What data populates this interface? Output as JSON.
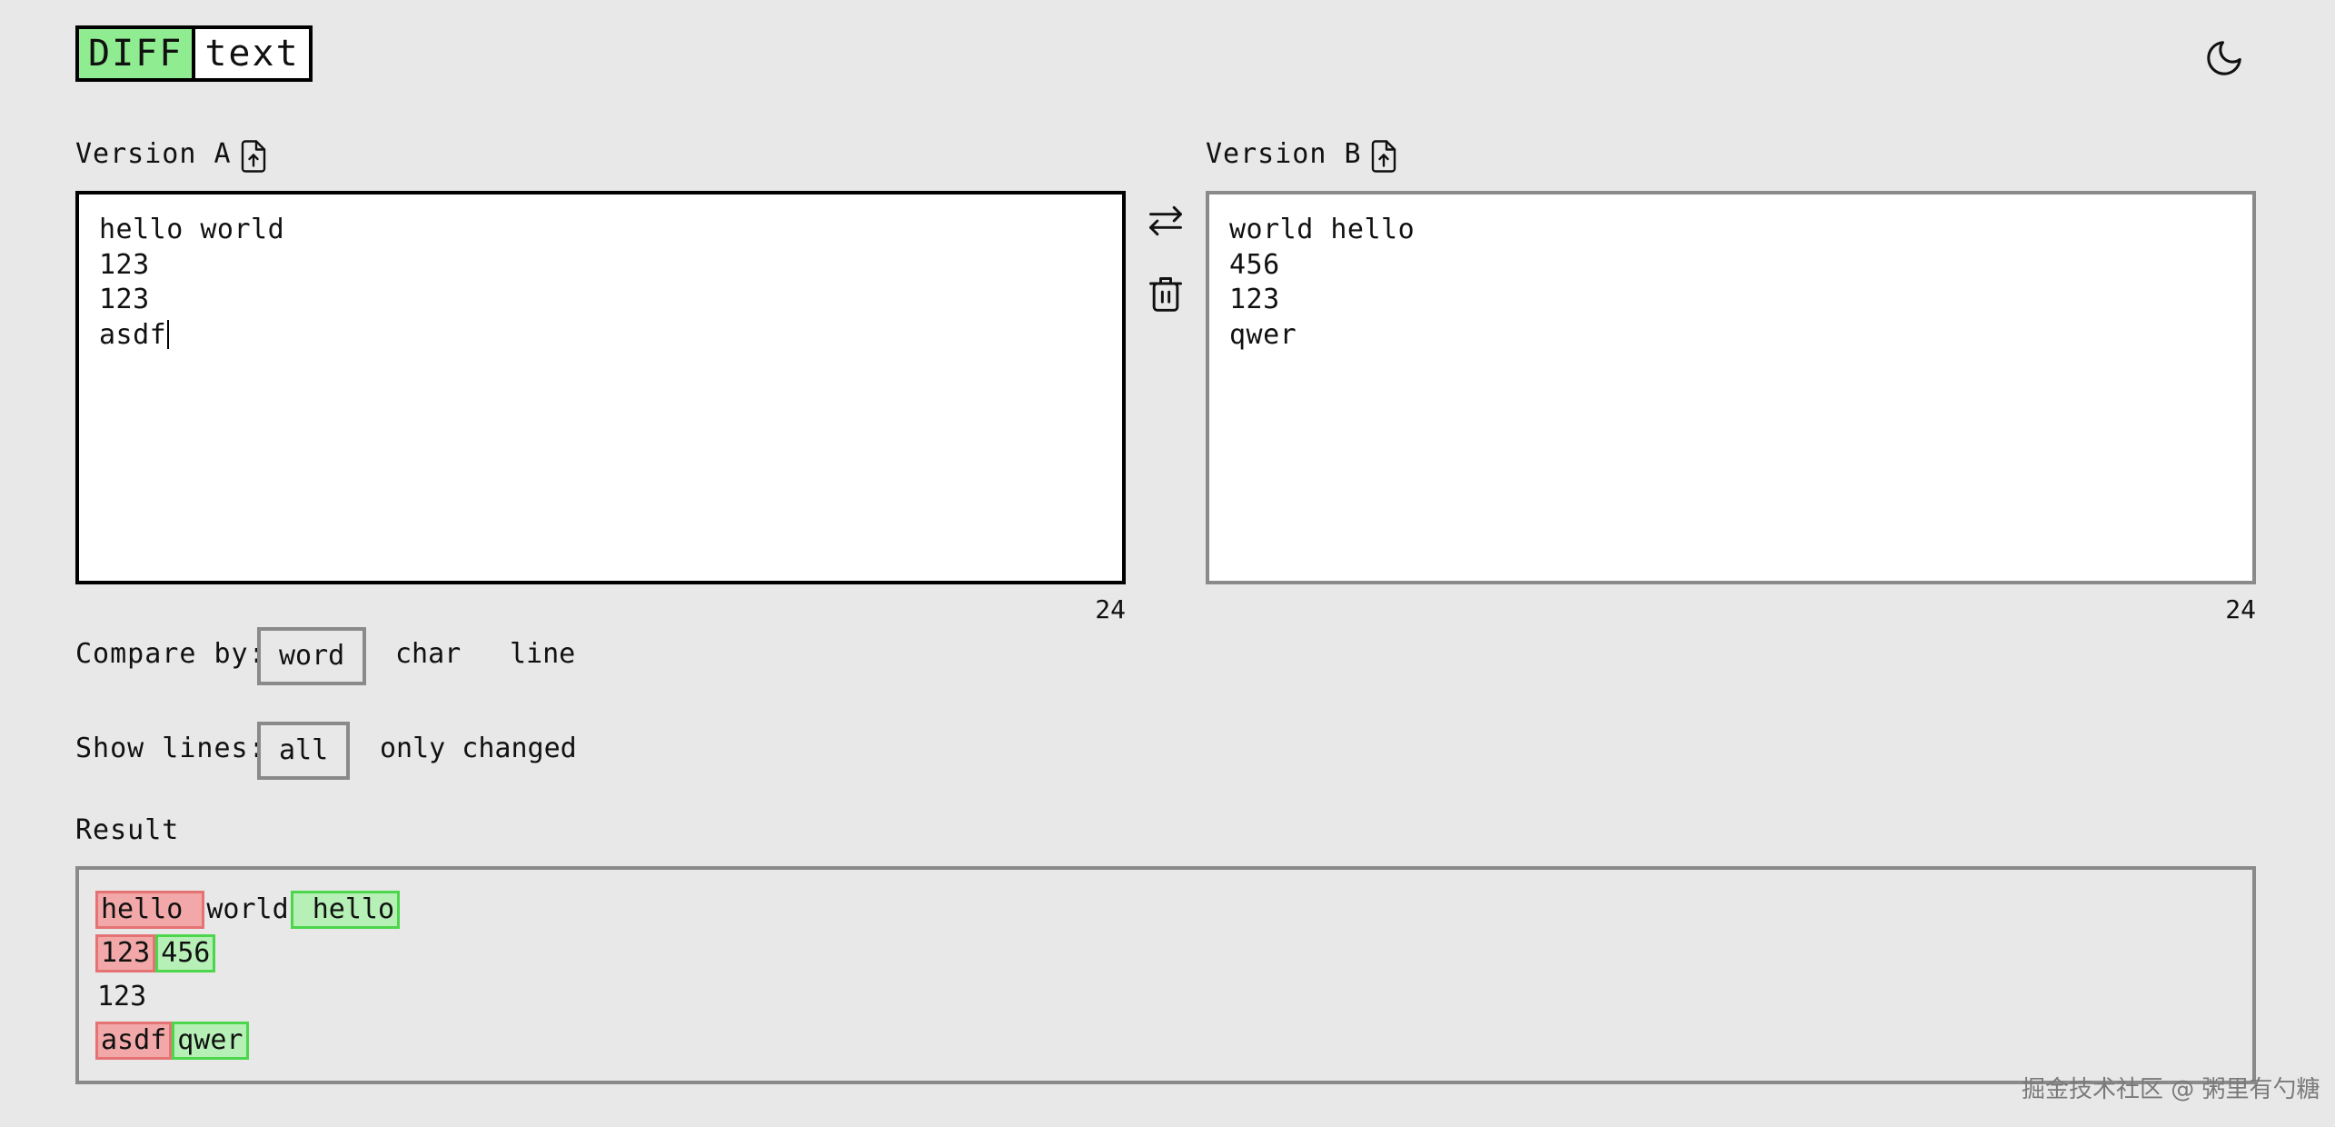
{
  "logo": {
    "part1": "DIFF",
    "part2": "text"
  },
  "theme_toggle": {
    "icon": "moon-icon"
  },
  "version_a": {
    "label": "Version A",
    "text": "hello world\n123\n123\nasdf",
    "count": "24"
  },
  "version_b": {
    "label": "Version B",
    "text": "world hello\n456\n123\nqwer",
    "count": "24"
  },
  "actions": {
    "swap_icon": "swap-icon",
    "clear_icon": "trash-icon"
  },
  "compare_by": {
    "label": "Compare by:",
    "options": [
      "word",
      "char",
      "line"
    ],
    "selected": "word"
  },
  "show_lines": {
    "label": "Show lines:",
    "options": [
      "all",
      "only changed"
    ],
    "selected": "all"
  },
  "result": {
    "label": "Result",
    "lines": [
      [
        {
          "type": "del",
          "text": "hello "
        },
        {
          "type": "eq",
          "text": "world"
        },
        {
          "type": "add",
          "text": " hello"
        }
      ],
      [
        {
          "type": "del",
          "text": "123"
        },
        {
          "type": "add",
          "text": "456"
        }
      ],
      [
        {
          "type": "eq",
          "text": "123"
        }
      ],
      [
        {
          "type": "del",
          "text": "asdf"
        },
        {
          "type": "add",
          "text": "qwer"
        }
      ]
    ]
  },
  "colors": {
    "background": "#e8e8e8",
    "logo_green": "#90ec90",
    "deleted_bg": "#f2a8a8",
    "added_bg": "#b6f0b6"
  },
  "watermark": "掘金技术社区 @ 粥里有勺糖"
}
